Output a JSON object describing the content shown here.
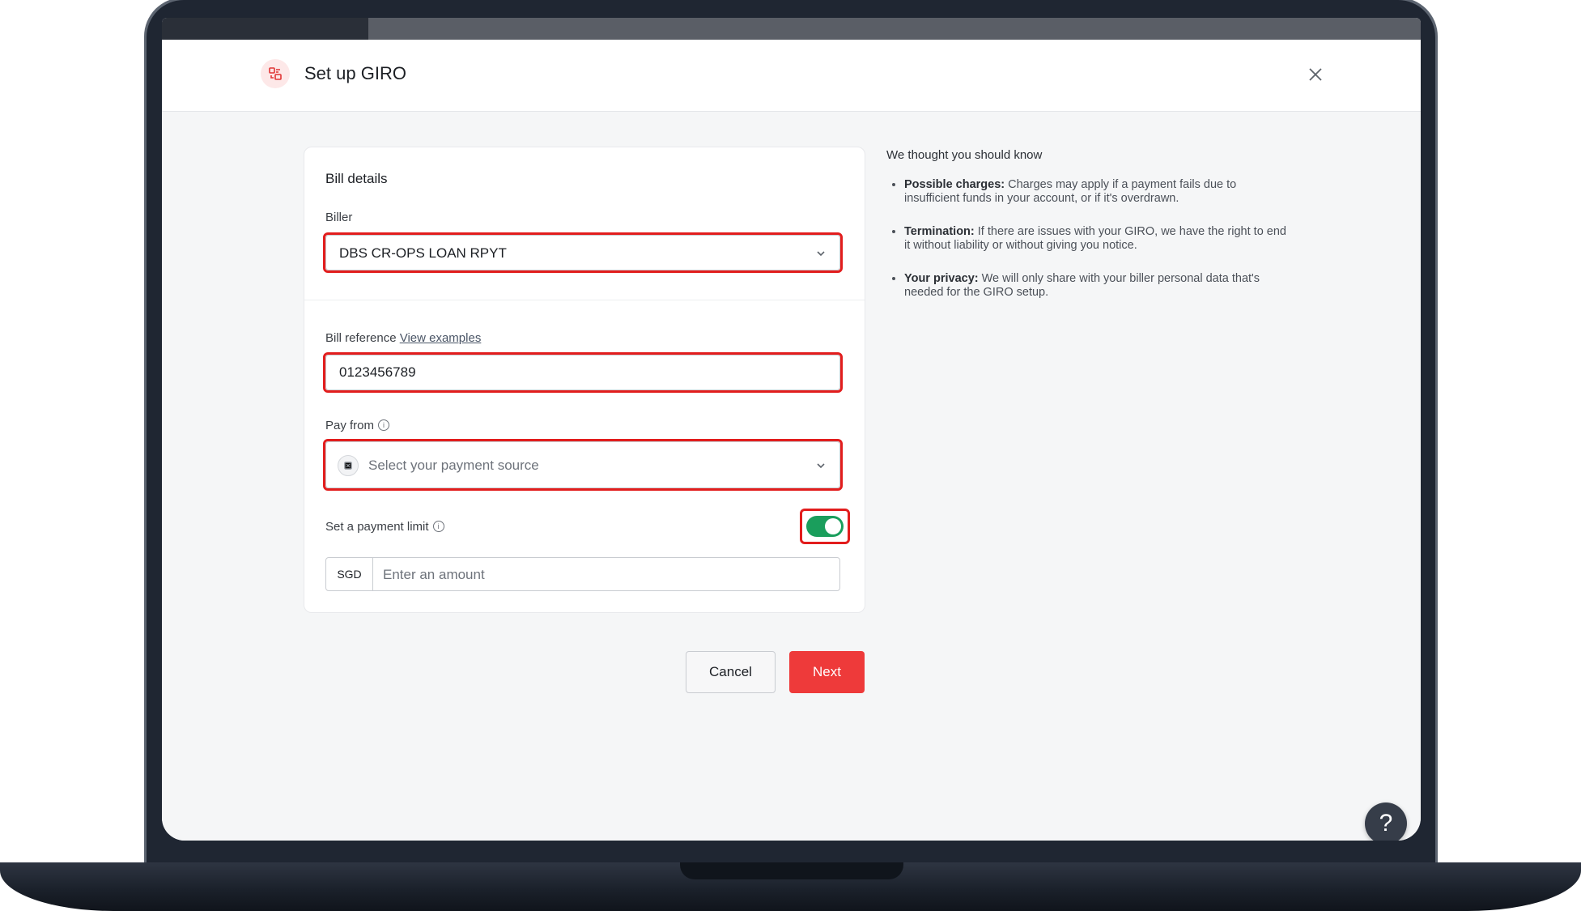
{
  "modal": {
    "title": "Set up GIRO"
  },
  "bill_details": {
    "title": "Bill details",
    "biller_label": "Biller",
    "biller_value": "DBS CR-OPS LOAN RPYT",
    "bill_reference_label": "Bill reference",
    "view_examples_link": "View examples",
    "bill_reference_value": "0123456789",
    "pay_from_label": "Pay from",
    "pay_from_placeholder": "Select your payment source",
    "payment_limit_label": "Set a payment limit",
    "payment_limit_enabled": true,
    "currency": "SGD",
    "amount_placeholder": "Enter an amount"
  },
  "buttons": {
    "cancel": "Cancel",
    "next": "Next"
  },
  "info": {
    "title": "We thought you should know",
    "items": [
      {
        "heading": "Possible charges:",
        "text": " Charges may apply if a payment fails due to insufficient funds in your account, or if it's overdrawn."
      },
      {
        "heading": "Termination:",
        "text": " If there are issues with your GIRO, we have the right to end it without liability or without giving you notice."
      },
      {
        "heading": "Your privacy:",
        "text": " We will only share with your biller personal data that's needed for the GIRO setup."
      }
    ]
  },
  "help": {
    "label": "?"
  },
  "colors": {
    "accent_red": "#ee3a3a",
    "highlight_red": "#e21d1d",
    "toggle_green": "#1a9e5c"
  }
}
